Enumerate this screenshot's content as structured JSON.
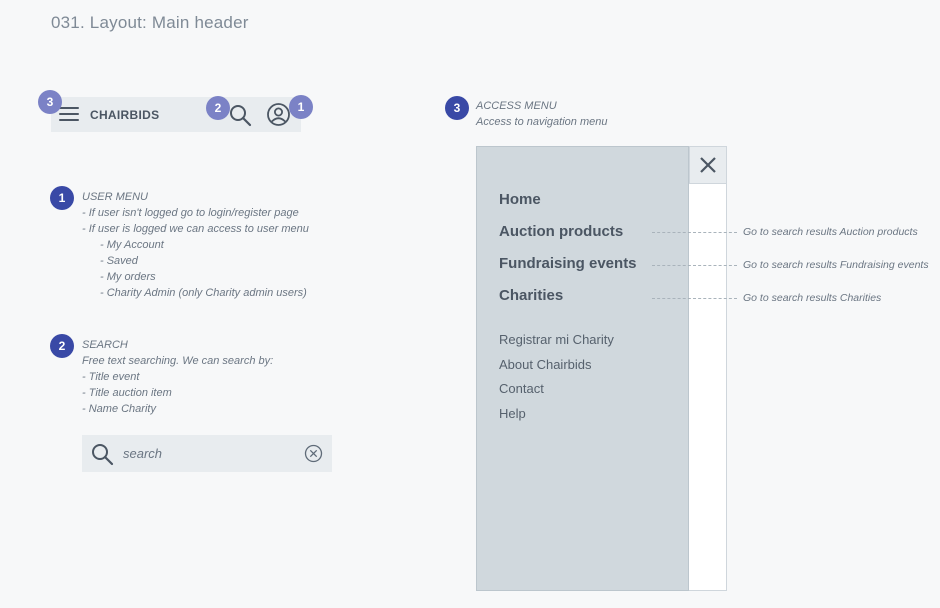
{
  "page_title": "031. Layout: Main header",
  "header": {
    "brand": "CHAIRBIDS",
    "badges": {
      "menu": "3",
      "search": "2",
      "user": "1"
    }
  },
  "user_menu_note": {
    "number": "1",
    "title": "USER MENU",
    "lines": [
      "- If user isn't logged go to login/register page",
      "- If user is logged we can access to user menu"
    ],
    "sub_lines": [
      "- My Account",
      "- Saved",
      "- My orders",
      "- Charity Admin (only Charity admin users)"
    ]
  },
  "search_note": {
    "number": "2",
    "title": "SEARCH",
    "lines": [
      "Free text searching. We can search by:",
      "- Title event",
      "- Title auction item",
      "- Name Charity"
    ]
  },
  "search_field": {
    "placeholder": "search"
  },
  "access_menu_note": {
    "number": "3",
    "title": "ACCESS MENU",
    "subtitle": "Access to navigation menu"
  },
  "access_menu": {
    "main_items": [
      "Home",
      "Auction products",
      "Fundraising events",
      "Charities"
    ],
    "secondary_items": [
      "Registrar mi Charity",
      "About Chairbids",
      "Contact",
      "Help"
    ],
    "link_notes": [
      "Go to search results Auction products",
      "Go to search results Fundraising events",
      "Go to search results Charities"
    ]
  },
  "colors": {
    "badge_light": "#7b82c6",
    "badge_dark": "#3949a6",
    "panel": "#d0d8dd",
    "header_bar": "#e8ecef"
  },
  "icons": [
    "hamburger-icon",
    "search-icon",
    "user-icon",
    "close-icon",
    "clear-icon"
  ]
}
